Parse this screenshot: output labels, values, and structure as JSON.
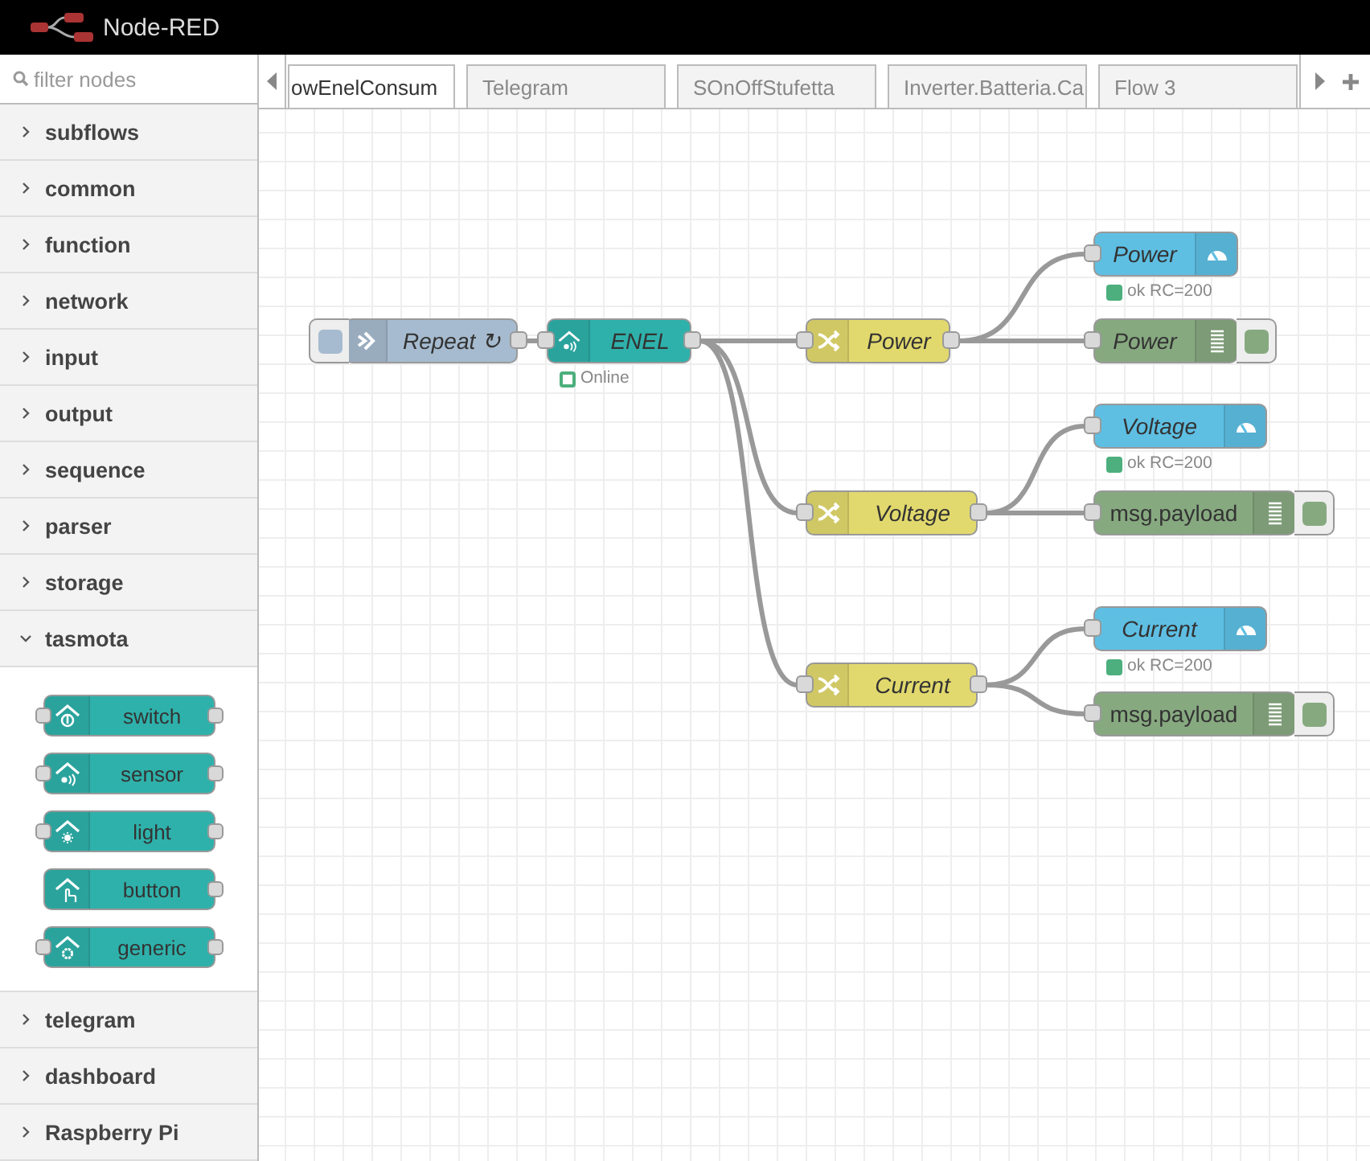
{
  "header": {
    "title": "Node-RED"
  },
  "palette": {
    "filter": {
      "placeholder": "filter nodes"
    },
    "categories": [
      {
        "label": "subflows",
        "expanded": false
      },
      {
        "label": "common",
        "expanded": false
      },
      {
        "label": "function",
        "expanded": false
      },
      {
        "label": "network",
        "expanded": false
      },
      {
        "label": "input",
        "expanded": false
      },
      {
        "label": "output",
        "expanded": false
      },
      {
        "label": "sequence",
        "expanded": false
      },
      {
        "label": "parser",
        "expanded": false
      },
      {
        "label": "storage",
        "expanded": false
      },
      {
        "label": "tasmota",
        "expanded": true,
        "nodes": [
          {
            "label": "switch",
            "kind": "switch",
            "has_input": true
          },
          {
            "label": "sensor",
            "kind": "sensor",
            "has_input": true
          },
          {
            "label": "light",
            "kind": "light",
            "has_input": true
          },
          {
            "label": "button",
            "kind": "button",
            "has_input": false
          },
          {
            "label": "generic",
            "kind": "generic",
            "has_input": true
          }
        ]
      },
      {
        "label": "telegram",
        "expanded": false
      },
      {
        "label": "dashboard",
        "expanded": false
      },
      {
        "label": "Raspberry Pi",
        "expanded": false
      }
    ]
  },
  "tabs": [
    {
      "label": "owEnelConsum",
      "selected": true
    },
    {
      "label": "Telegram",
      "selected": false
    },
    {
      "label": "SOnOffStufetta",
      "selected": false
    },
    {
      "label": "Inverter.Batteria.Ca",
      "selected": false
    },
    {
      "label": "Flow 3",
      "selected": false
    }
  ],
  "flow": {
    "nodes": [
      {
        "kind": "inject",
        "label": "Repeat ↻",
        "named": true
      },
      {
        "kind": "tasmota",
        "label": "ENEL",
        "named": true,
        "status": {
          "kind": "ring",
          "text": "Online"
        }
      },
      {
        "kind": "switch",
        "label": "Power",
        "named": true
      },
      {
        "kind": "switch",
        "label": "Voltage",
        "named": true
      },
      {
        "kind": "switch",
        "label": "Current",
        "named": true
      },
      {
        "kind": "gauge",
        "label": "Power",
        "named": true,
        "status": {
          "kind": "dot",
          "text": "ok RC=200"
        }
      },
      {
        "kind": "debug",
        "label": "Power",
        "named": true,
        "active": true
      },
      {
        "kind": "gauge",
        "label": "Voltage",
        "named": true,
        "status": {
          "kind": "dot",
          "text": "ok RC=200"
        }
      },
      {
        "kind": "debug",
        "label": "msg.payload",
        "named": false,
        "active": true
      },
      {
        "kind": "gauge",
        "label": "Current",
        "named": true,
        "status": {
          "kind": "dot",
          "text": "ok RC=200"
        }
      },
      {
        "kind": "debug",
        "label": "msg.payload",
        "named": false,
        "active": true
      }
    ]
  }
}
